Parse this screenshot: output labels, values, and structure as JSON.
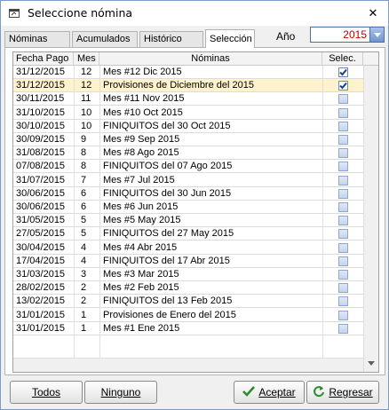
{
  "window": {
    "title": "Seleccione nómina",
    "close_glyph": "✕"
  },
  "tabs": [
    {
      "label": "Nóminas",
      "active": false
    },
    {
      "label": "Acumulados",
      "active": false
    },
    {
      "label": "Histórico",
      "active": false
    },
    {
      "label": "Selección",
      "active": true
    }
  ],
  "year": {
    "label": "Año",
    "value": "2015"
  },
  "table": {
    "columns": [
      "Fecha Pago",
      "Mes",
      "Nóminas",
      "Selec."
    ],
    "rows": [
      {
        "fecha": "31/12/2015",
        "mes": "12",
        "nomina": "Mes #12 Dic 2015",
        "selected": true
      },
      {
        "fecha": "31/12/2015",
        "mes": "12",
        "nomina": "Provisiones de Diciembre del 2015",
        "selected": true
      },
      {
        "fecha": "30/11/2015",
        "mes": "11",
        "nomina": "Mes #11 Nov 2015",
        "selected": false
      },
      {
        "fecha": "31/10/2015",
        "mes": "10",
        "nomina": "Mes #10 Oct 2015",
        "selected": false
      },
      {
        "fecha": "30/10/2015",
        "mes": "10",
        "nomina": "FINIQUITOS del 30 Oct 2015",
        "selected": false
      },
      {
        "fecha": "30/09/2015",
        "mes": "9",
        "nomina": "Mes #9 Sep 2015",
        "selected": false
      },
      {
        "fecha": "31/08/2015",
        "mes": "8",
        "nomina": "Mes #8 Ago 2015",
        "selected": false
      },
      {
        "fecha": "07/08/2015",
        "mes": "8",
        "nomina": "FINIQUITOS del 07 Ago 2015",
        "selected": false
      },
      {
        "fecha": "31/07/2015",
        "mes": "7",
        "nomina": "Mes #7 Jul 2015",
        "selected": false
      },
      {
        "fecha": "30/06/2015",
        "mes": "6",
        "nomina": "FINIQUITOS del 30 Jun 2015",
        "selected": false
      },
      {
        "fecha": "30/06/2015",
        "mes": "6",
        "nomina": "Mes #6 Jun 2015",
        "selected": false
      },
      {
        "fecha": "31/05/2015",
        "mes": "5",
        "nomina": "Mes #5 May 2015",
        "selected": false
      },
      {
        "fecha": "27/05/2015",
        "mes": "5",
        "nomina": "FINIQUITOS del 27 May 2015",
        "selected": false
      },
      {
        "fecha": "30/04/2015",
        "mes": "4",
        "nomina": "Mes #4 Abr 2015",
        "selected": false
      },
      {
        "fecha": "17/04/2015",
        "mes": "4",
        "nomina": "FINIQUITOS del 17 Abr 2015",
        "selected": false
      },
      {
        "fecha": "31/03/2015",
        "mes": "3",
        "nomina": "Mes #3 Mar 2015",
        "selected": false
      },
      {
        "fecha": "28/02/2015",
        "mes": "2",
        "nomina": "Mes #2 Feb 2015",
        "selected": false
      },
      {
        "fecha": "13/02/2015",
        "mes": "2",
        "nomina": "FINIQUITOS del 13 Feb 2015",
        "selected": false
      },
      {
        "fecha": "31/01/2015",
        "mes": "1",
        "nomina": "Provisiones de Enero del 2015",
        "selected": false
      },
      {
        "fecha": "31/01/2015",
        "mes": "1",
        "nomina": "Mes #1 Ene 2015",
        "selected": false
      }
    ],
    "highlighted_row": 1
  },
  "buttons": {
    "todos": "Todos",
    "ninguno": "Ninguno",
    "aceptar": "Aceptar",
    "regresar": "Regresar"
  },
  "icons": {
    "app": "window-app-icon",
    "accept": "check-icon",
    "back": "refresh-back-icon"
  },
  "colors": {
    "year_value": "#c00000",
    "highlight_row": "#fff2cc",
    "accept_icon": "#2e8b2e"
  }
}
